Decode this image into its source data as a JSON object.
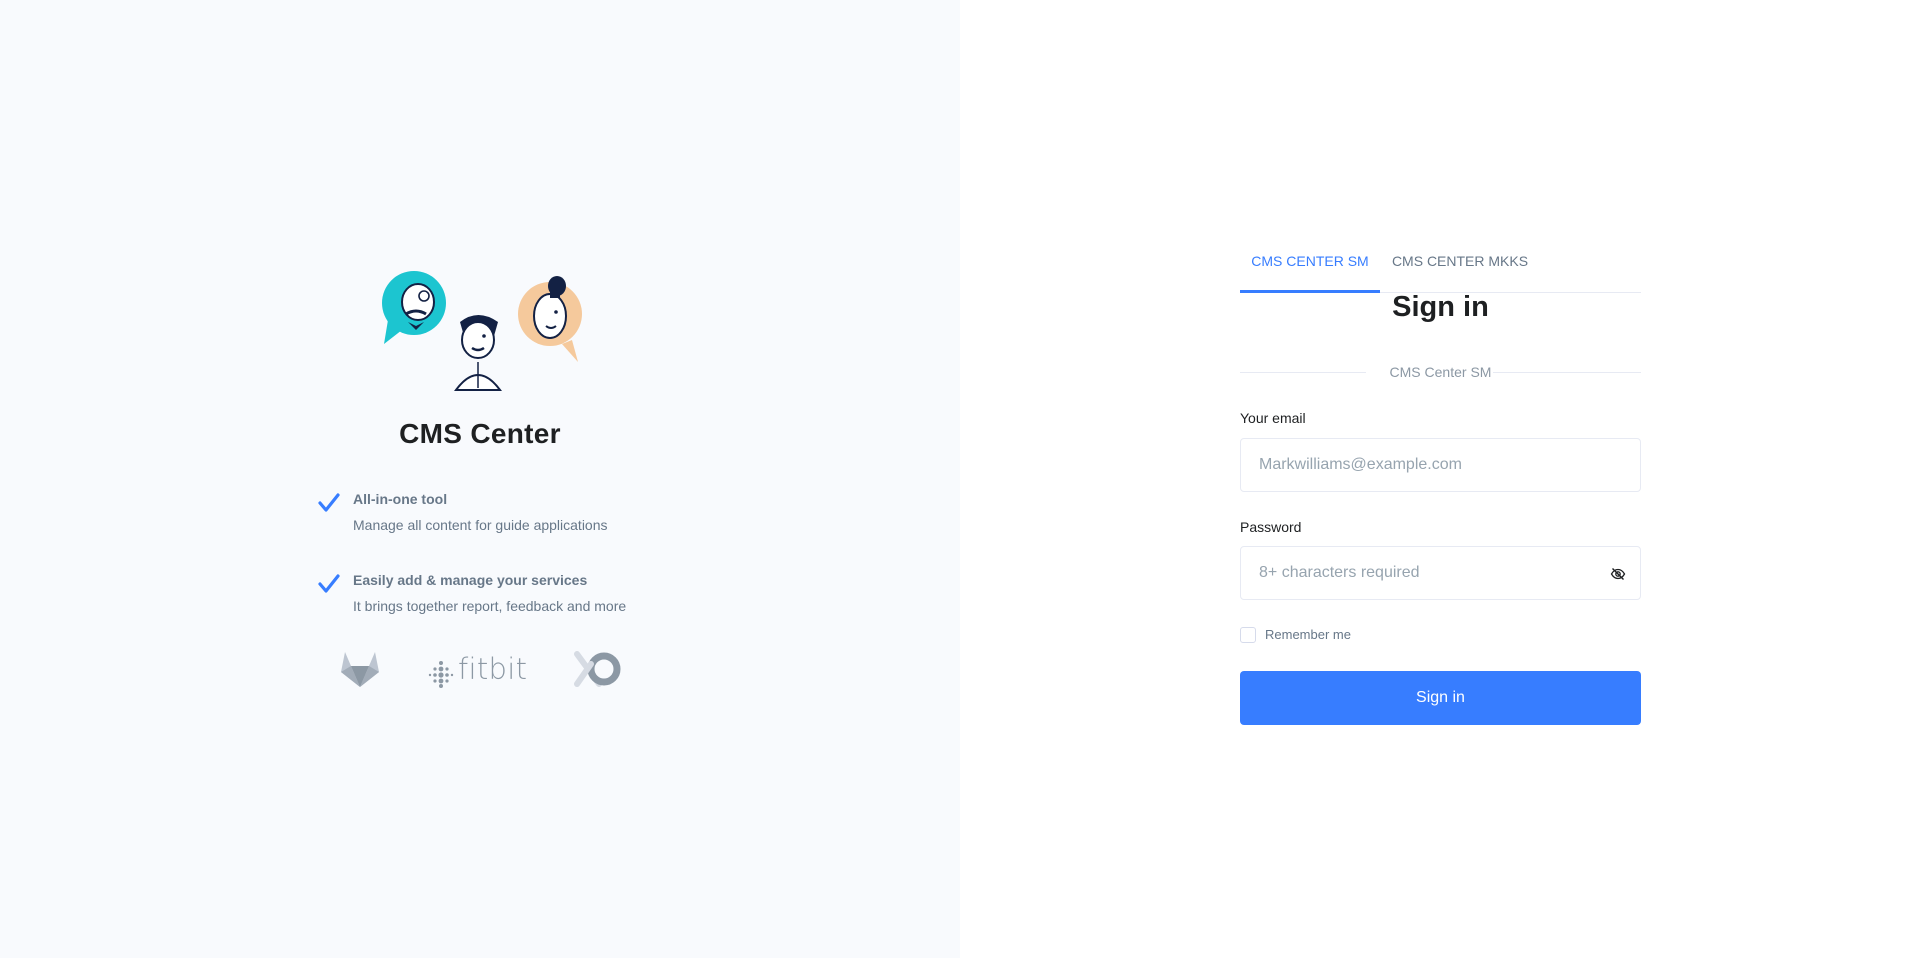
{
  "hero": {
    "illustration_icon": "people-avatars-illustration",
    "title": "CMS Center",
    "features": [
      {
        "icon": "check-icon",
        "title": "All-in-one tool",
        "description": "Manage all content for guide applications"
      },
      {
        "icon": "check-icon",
        "title": "Easily add & manage your services",
        "description": "It brings together report, feedback and more"
      }
    ],
    "partner_logos": [
      "gitlab-logo",
      "fitbit-logo",
      "ring-logo"
    ],
    "fitbit_wordmark": "fitbit"
  },
  "auth": {
    "tabs": [
      {
        "label": "CMS CENTER SM",
        "active": true
      },
      {
        "label": "CMS CENTER MKKS",
        "active": false
      }
    ],
    "title": "Sign in",
    "divider_text": "CMS Center SM",
    "email": {
      "label": "Your email",
      "placeholder": "Markwilliams@example.com",
      "value": ""
    },
    "password": {
      "label": "Password",
      "placeholder": "8+ characters required",
      "value": "",
      "toggle_icon": "eye-slash-icon"
    },
    "remember": {
      "label": "Remember me",
      "checked": false
    },
    "submit_label": "Sign in"
  },
  "colors": {
    "primary": "#377dff",
    "left_bg": "#f8fafd",
    "muted_text": "#677788",
    "illustration_teal": "#1cc5d0",
    "illustration_peach": "#f5c99c",
    "navy": "#132144"
  }
}
